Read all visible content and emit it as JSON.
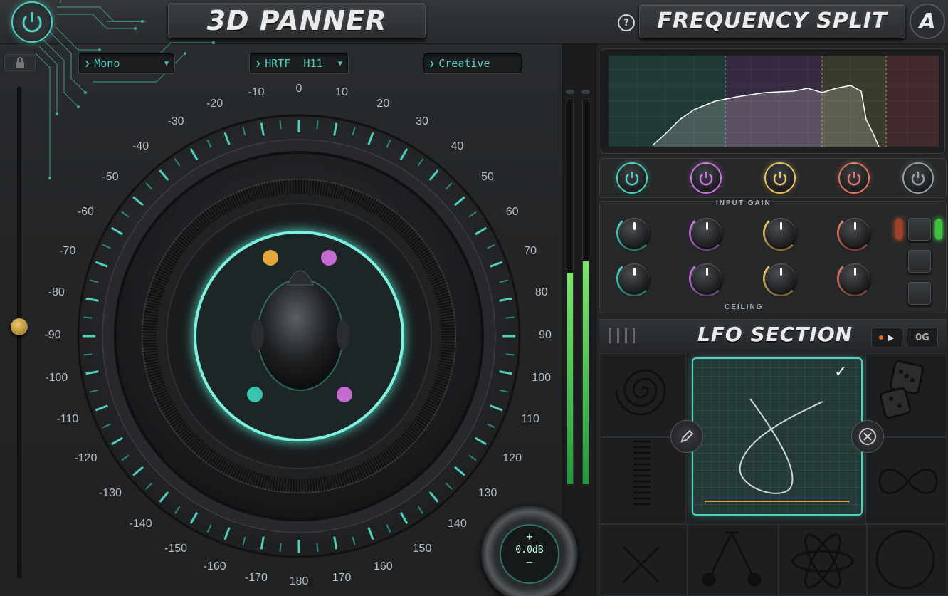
{
  "left_title": "3D PANNER",
  "right_title": "FREQUENCY SPLIT",
  "help_icon": "?",
  "logo_letter": "A",
  "dropdowns": [
    {
      "value": "Mono",
      "has_caret": true
    },
    {
      "value": "HRTF  H11",
      "has_caret": true
    },
    {
      "value": "Creative",
      "has_caret": false
    }
  ],
  "dial_ticks": [
    "-10",
    "0",
    "10",
    "20",
    "30",
    "40",
    "50",
    "60",
    "70",
    "80",
    "90",
    "100",
    "110",
    "120",
    "130",
    "140",
    "150",
    "160",
    "170",
    "180",
    "-170",
    "-160",
    "-150",
    "-140",
    "-130",
    "-120",
    "-110",
    "-100",
    "-90",
    "-80",
    "-70",
    "-60",
    "-50",
    "-40",
    "-30",
    "-20"
  ],
  "output_gain": {
    "plus": "+",
    "value": "0.0dB",
    "minus": "−"
  },
  "input_gain_label": "INPUT GAIN",
  "ceiling_label": "CEILING",
  "lfo_title": "LFO SECTION",
  "lfo_play_icon": "▶",
  "lfo_og_label": "0G",
  "check_mark": "✓",
  "band_colors": [
    "#4fd1c0",
    "#c878e0",
    "#e8c468",
    "#e07a68",
    "#9aa0a4"
  ],
  "meter_levels": [
    0.55,
    0.58
  ]
}
